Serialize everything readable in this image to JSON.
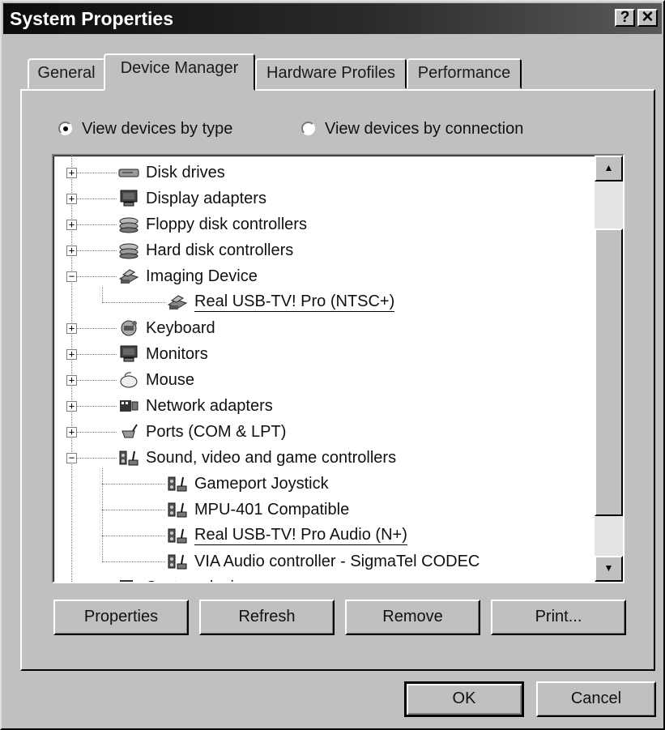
{
  "window": {
    "title": "System Properties",
    "help_label": "?",
    "close_label": "✕"
  },
  "tabs": [
    {
      "label": "General",
      "active": false
    },
    {
      "label": "Device Manager",
      "active": true
    },
    {
      "label": "Hardware Profiles",
      "active": false
    },
    {
      "label": "Performance",
      "active": false
    }
  ],
  "view": {
    "by_type_label": "View devices by type",
    "by_connection_label": "View devices by connection",
    "selected": "by_type"
  },
  "tree": [
    {
      "label": "Disk drives",
      "expanded": false,
      "icon": "disk-drive-icon"
    },
    {
      "label": "Display adapters",
      "expanded": false,
      "icon": "monitor-icon"
    },
    {
      "label": "Floppy disk controllers",
      "expanded": false,
      "icon": "controller-icon"
    },
    {
      "label": "Hard disk controllers",
      "expanded": false,
      "icon": "controller-icon"
    },
    {
      "label": "Imaging Device",
      "expanded": true,
      "icon": "scanner-icon",
      "children": [
        {
          "label": "Real USB-TV! Pro (NTSC+)",
          "icon": "scanner-icon",
          "underlined": true
        }
      ]
    },
    {
      "label": "Keyboard",
      "expanded": false,
      "icon": "keyboard-icon"
    },
    {
      "label": "Monitors",
      "expanded": false,
      "icon": "monitor-icon"
    },
    {
      "label": "Mouse",
      "expanded": false,
      "icon": "mouse-icon"
    },
    {
      "label": "Network adapters",
      "expanded": false,
      "icon": "network-card-icon"
    },
    {
      "label": "Ports (COM & LPT)",
      "expanded": false,
      "icon": "port-plug-icon"
    },
    {
      "label": "Sound, video and game controllers",
      "expanded": true,
      "icon": "speaker-joystick-icon",
      "children": [
        {
          "label": "Gameport Joystick",
          "icon": "speaker-joystick-icon",
          "underlined": false
        },
        {
          "label": "MPU-401 Compatible",
          "icon": "speaker-joystick-icon",
          "underlined": false
        },
        {
          "label": "Real USB-TV! Pro Audio (N+)",
          "icon": "speaker-joystick-icon",
          "underlined": true
        },
        {
          "label": "VIA Audio controller - SigmaTel CODEC",
          "icon": "speaker-joystick-icon",
          "underlined": false
        }
      ]
    },
    {
      "label": "System devices",
      "expanded": false,
      "icon": "computer-icon"
    }
  ],
  "scrollbar": {
    "up_label": "▲",
    "down_label": "▼"
  },
  "buttons": {
    "properties": "Properties",
    "refresh": "Refresh",
    "remove": "Remove",
    "print": "Print...",
    "ok": "OK",
    "cancel": "Cancel"
  },
  "colors": {
    "face": "#c0c0c0",
    "title_bar": "#0c0c0c",
    "tree_bg": "#ffffff"
  }
}
